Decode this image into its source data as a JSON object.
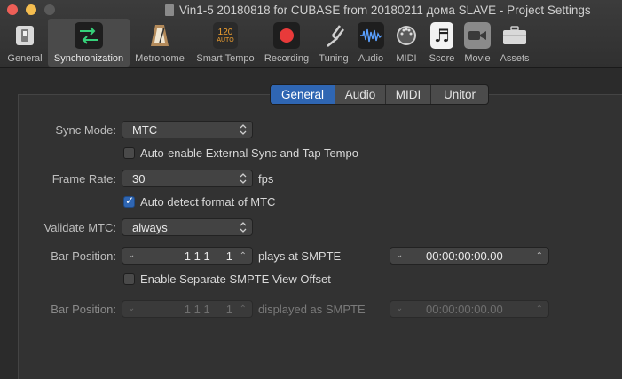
{
  "window": {
    "title": "Vin1-5 20180818 for CUBASE from 20180211 дома SLAVE - Project Settings"
  },
  "toolbar": {
    "items": [
      {
        "label": "General",
        "icon": "general-icon"
      },
      {
        "label": "Synchronization",
        "icon": "synchronization-icon",
        "active": true
      },
      {
        "label": "Metronome",
        "icon": "metronome-icon"
      },
      {
        "label": "Smart Tempo",
        "icon": "smart-tempo-icon",
        "icon_top": "120",
        "icon_bottom": "AUTO"
      },
      {
        "label": "Recording",
        "icon": "record-icon"
      },
      {
        "label": "Tuning",
        "icon": "tuning-fork-icon"
      },
      {
        "label": "Audio",
        "icon": "waveform-icon"
      },
      {
        "label": "MIDI",
        "icon": "midi-icon"
      },
      {
        "label": "Score",
        "icon": "score-icon"
      },
      {
        "label": "Movie",
        "icon": "movie-camera-icon"
      },
      {
        "label": "Assets",
        "icon": "assets-briefcase-icon"
      }
    ]
  },
  "tabs": [
    "General",
    "Audio",
    "MIDI",
    "Unitor"
  ],
  "selected_tab": "General",
  "form": {
    "sync_mode_label": "Sync Mode:",
    "sync_mode_value": "MTC",
    "auto_enable_label": "Auto-enable External Sync and Tap Tempo",
    "auto_enable_checked": false,
    "frame_rate_label": "Frame Rate:",
    "frame_rate_value": "30",
    "frame_rate_unit": "fps",
    "auto_detect_label": "Auto detect format of MTC",
    "auto_detect_checked": true,
    "validate_mtc_label": "Validate MTC:",
    "validate_mtc_value": "always",
    "bar_position_label": "Bar Position:",
    "bar_position_value": "1 1 1     1",
    "plays_at_label": "plays at SMPTE",
    "smpte_value": "00:00:00:00.00",
    "separate_offset_label": "Enable Separate SMPTE View Offset",
    "separate_offset_checked": false,
    "bar_position2_label": "Bar Position:",
    "bar_position2_value": "1 1 1     1",
    "displayed_as_label": "displayed as SMPTE",
    "smpte2_value": "00:00:00:00.00"
  },
  "colors": {
    "accent": "#2f66b3",
    "close": "#ee5f57",
    "minimize": "#f5bd4f"
  }
}
